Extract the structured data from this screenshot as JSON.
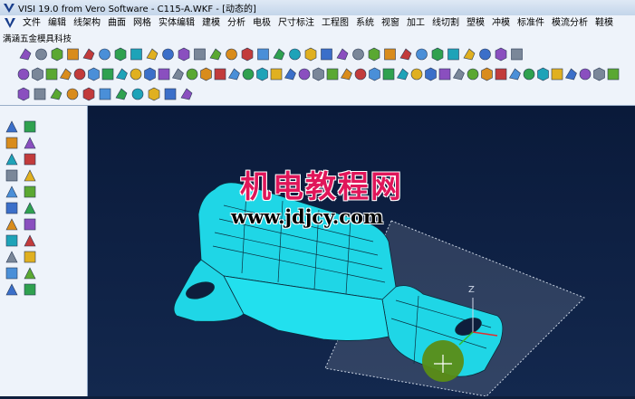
{
  "window": {
    "title": "VISI 19.0  from Vero Software - C115-A.WKF - [动态的]"
  },
  "menubar": {
    "items": [
      "文件",
      "编辑",
      "线架构",
      "曲面",
      "网格",
      "实体编辑",
      "建模",
      "分析",
      "电极",
      "尺寸标注",
      "工程图",
      "系统",
      "视窗",
      "加工",
      "线切割",
      "塑模",
      "冲模",
      "标准件",
      "模流分析",
      "鞋模"
    ]
  },
  "company_label": "满涵五金模具科技",
  "viewport": {
    "watermark_cn": "机电教程网",
    "watermark_url": "www.jdjcy.com",
    "axis_label": "Z",
    "part_color": "#1fd6e6",
    "background_color": "#0e1e3c"
  },
  "toolbar_rows": [
    {
      "count": 32
    },
    {
      "count": 44
    },
    {
      "count": 11
    }
  ],
  "left_panel": {
    "icon_rows": 11
  }
}
